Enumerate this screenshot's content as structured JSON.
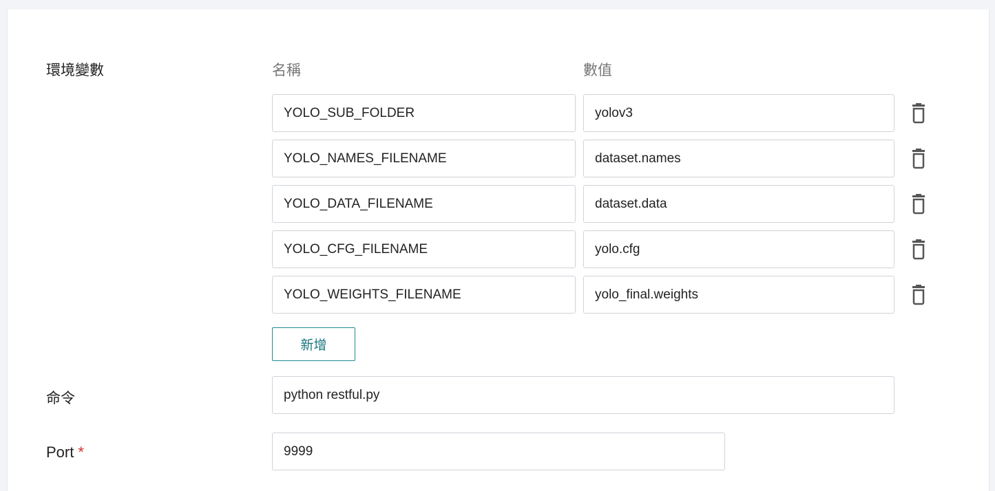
{
  "env": {
    "label": "環境變數",
    "name_header": "名稱",
    "value_header": "數值",
    "rows": [
      {
        "name": "YOLO_SUB_FOLDER",
        "value": "yolov3"
      },
      {
        "name": "YOLO_NAMES_FILENAME",
        "value": "dataset.names"
      },
      {
        "name": "YOLO_DATA_FILENAME",
        "value": "dataset.data"
      },
      {
        "name": "YOLO_CFG_FILENAME",
        "value": "yolo.cfg"
      },
      {
        "name": "YOLO_WEIGHTS_FILENAME",
        "value": "yolo_final.weights"
      }
    ],
    "add_label": "新增",
    "delete_icon": "trash-icon"
  },
  "command": {
    "label": "命令",
    "value": "python restful.py"
  },
  "port": {
    "label": "Port",
    "required_mark": "*",
    "value": "9999"
  },
  "colors": {
    "accent": "#1e8a93",
    "required": "#d0312d",
    "header_text": "#777777"
  }
}
